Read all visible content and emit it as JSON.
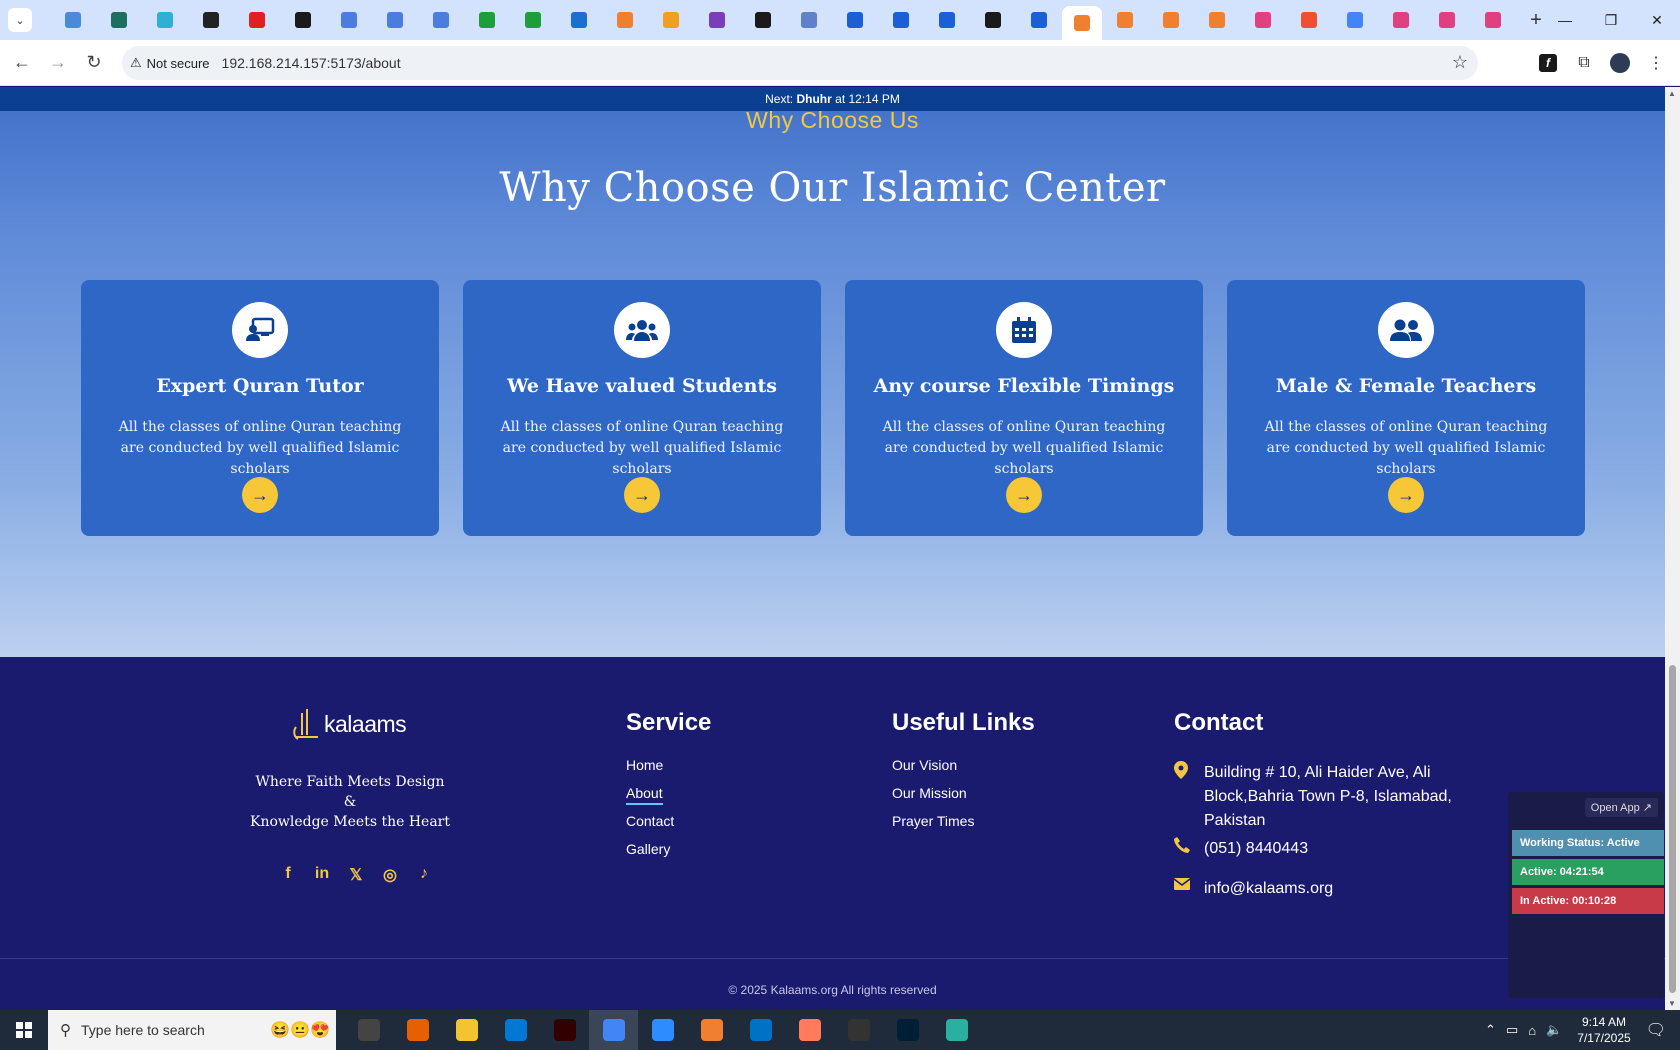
{
  "browser": {
    "tab_icons": [
      "#4a8ad8",
      "#1f6f5f",
      "#2eb0d6",
      "#222222",
      "#e02020",
      "#1a1a1a",
      "#4a7dde",
      "#4a7dde",
      "#4a7dde",
      "#1e9e3a",
      "#1e9e3a",
      "#1a6fd1",
      "#f08030",
      "#f0a020",
      "#7a3fb8",
      "#1a1a1a",
      "#6080c8",
      "#1a5fd6",
      "#1a5fd6",
      "#1a5fd6",
      "#1a1a1a",
      "#1a5fd6",
      "#f08030",
      "#f08030",
      "#f08030",
      "#f08030",
      "#e04080",
      "#f05030",
      "#4285f4",
      "#e04080",
      "#e04080",
      "#e04080"
    ],
    "active_tab_index": 22,
    "security_label": "Not secure",
    "url": "192.168.214.157:5173/about"
  },
  "prayer": {
    "prefix": "Next:",
    "name": "Dhuhr",
    "suffix": "at 12:14 PM"
  },
  "section": {
    "eyebrow": "Why Choose Us",
    "title": "Why Choose Our Islamic Center"
  },
  "cards": [
    {
      "icon": "chalkboard-teacher-icon",
      "title": "Expert Quran Tutor",
      "desc": "All the classes of online Quran teaching are conducted by well qualified Islamic scholars",
      "arrow": "→"
    },
    {
      "icon": "users-icon",
      "title": "We Have valued Students",
      "desc": "All the classes of online Quran teaching are conducted by well qualified Islamic scholars",
      "arrow": "→"
    },
    {
      "icon": "calendar-icon",
      "title": "Any course Flexible Timings",
      "desc": "All the classes of online Quran teaching are conducted by well qualified Islamic scholars",
      "arrow": "→"
    },
    {
      "icon": "user-friends-icon",
      "title": "Male & Female Teachers",
      "desc": "All the classes of online Quran teaching are conducted by well qualified Islamic scholars",
      "arrow": "→"
    }
  ],
  "footer": {
    "logo_text": "kalaams",
    "tagline_1": "Where Faith Meets Design",
    "tagline_2": "&",
    "tagline_3": "Knowledge Meets the Heart",
    "socials": [
      "f",
      "in",
      "𝕏",
      "◎",
      "♪"
    ],
    "service": {
      "heading": "Service",
      "items": [
        "Home",
        "About",
        "Contact",
        "Gallery"
      ],
      "active_index": 1
    },
    "links": {
      "heading": "Useful Links",
      "items": [
        "Our Vision",
        "Our Mission",
        "Prayer Times"
      ]
    },
    "contact": {
      "heading": "Contact",
      "address_1": "Building # 10, Ali Haider Ave, Ali",
      "address_2": "Block,Bahria Town P-8, Islamabad,",
      "address_3": "Pakistan",
      "phone": "(051) 8440443",
      "email": "info@kalaams.org"
    },
    "copyright": "© 2025 Kalaams.org All rights reserved"
  },
  "widget": {
    "open_label": "Open App ↗",
    "working": "Working Status: Active",
    "active": "Active: 04:21:54",
    "inactive": "In Active: 00:10:28",
    "colors": {
      "working": "#4f8fb0",
      "active": "#2aa060",
      "inactive": "#c83a48"
    }
  },
  "taskbar": {
    "search_placeholder": "Type here to search",
    "app_colors": [
      "#444444",
      "#e66000",
      "#f4c430",
      "#0078d4",
      "#330000",
      "#4285f4",
      "#2d8cff",
      "#f08030",
      "#0072c6",
      "#ff7b5c",
      "#333333",
      "#001e36",
      "#2ab0a0"
    ],
    "time": "9:14 AM",
    "date": "7/17/2025"
  }
}
